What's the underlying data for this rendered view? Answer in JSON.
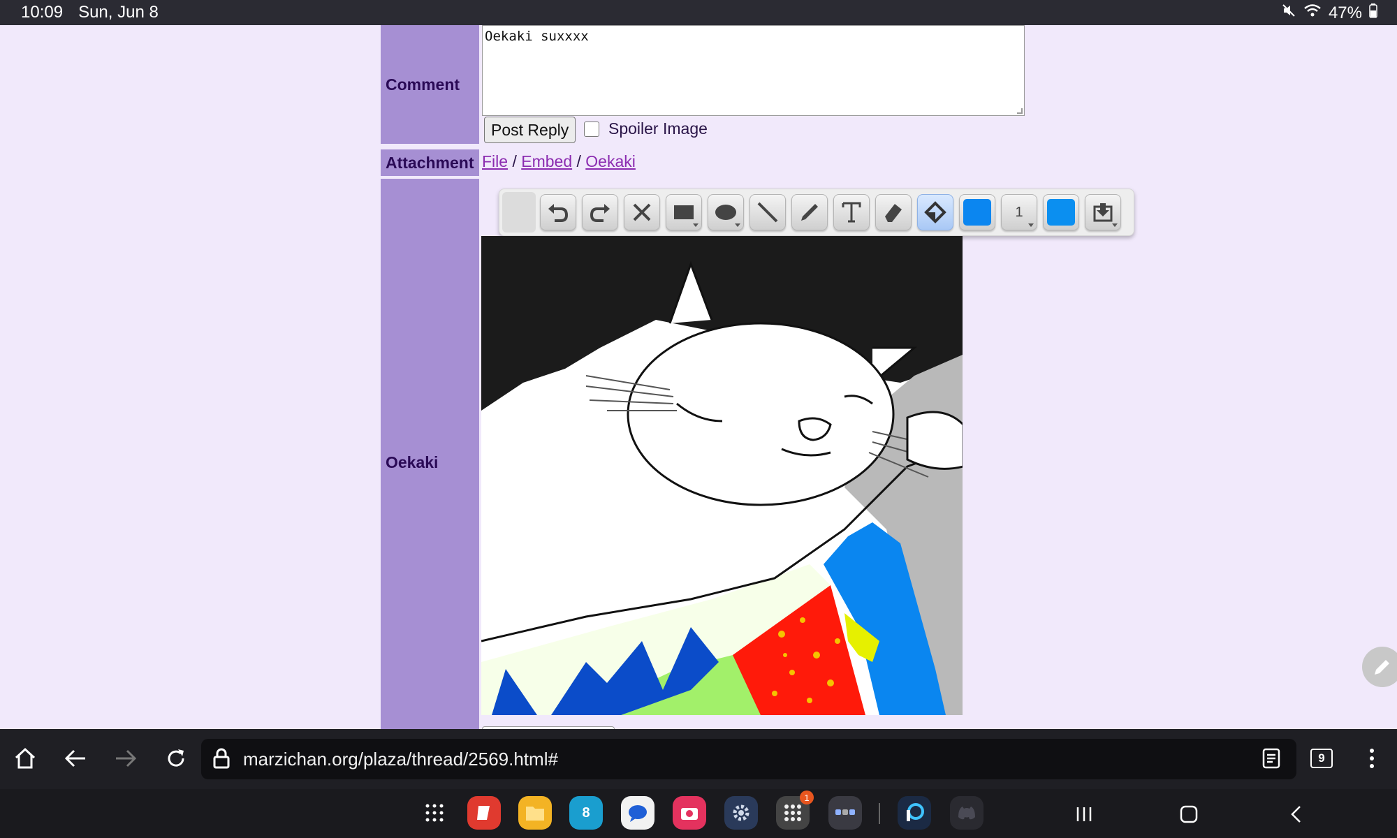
{
  "status_bar": {
    "time": "10:09",
    "date": "Sun, Jun 8",
    "battery": "47%",
    "icons": [
      "gallery-icon",
      "cloud-icon",
      "sync-icon",
      "dot-icon",
      "mute-icon",
      "wifi-icon",
      "battery-icon"
    ]
  },
  "form": {
    "comment_label": "Comment",
    "comment_value": "Oekaki suxxxx",
    "post_reply_label": "Post Reply",
    "spoiler_label": "Spoiler Image",
    "spoiler_checked": false,
    "attachment_label": "Attachment",
    "attachment_links": [
      "File",
      "Embed",
      "Oekaki"
    ],
    "attachment_separator": "/",
    "oekaki_label": "Oekaki"
  },
  "toolbar": {
    "tools": [
      "undo-icon",
      "redo-icon",
      "clear-icon",
      "rectangle-icon",
      "ellipse-icon",
      "line-icon",
      "pen-icon",
      "text-icon",
      "eraser-icon",
      "fill-icon",
      "primary-color",
      "brush-size",
      "secondary-color",
      "save-icon"
    ],
    "active_tool": "fill-icon",
    "brush_size": "1",
    "primary_color": "#0b86f0",
    "secondary_color": "#0b8ff0"
  },
  "browser": {
    "url": "marzichan.org/plaza/thread/2569.html#",
    "tab_count": "9"
  },
  "dock": {
    "calendar_day": "8",
    "badge_count": "1"
  },
  "colors": {
    "page_bg": "#f1e9fb",
    "label_bg": "#a68fd3",
    "label_text": "#2a0a56",
    "link": "#8b2bb0"
  }
}
